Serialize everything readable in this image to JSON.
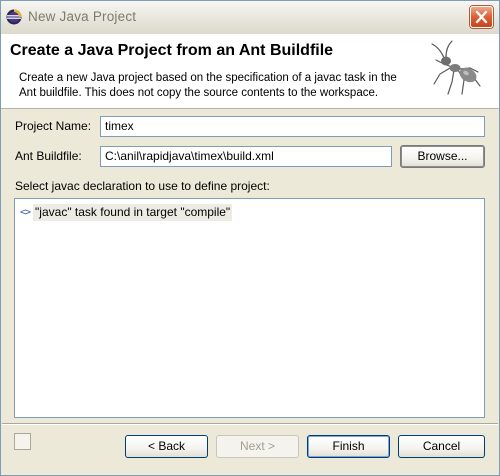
{
  "window": {
    "title": "New Java Project",
    "icon": "eclipse-icon",
    "close_icon": "close-icon"
  },
  "banner": {
    "title": "Create a Java Project from an Ant Buildfile",
    "description": "Create a new Java project based on the specification of a javac task in the Ant buildfile. This does not copy the source contents to the workspace.",
    "icon": "ant-icon"
  },
  "form": {
    "project_name_label": "Project Name:",
    "project_name_value": "timex",
    "ant_buildfile_label": "Ant Buildfile:",
    "ant_buildfile_value": "C:\\anil\\rapidjava\\timex\\build.xml",
    "browse_label": "Browse...",
    "javac_select_label": "Select javac declaration to use to define project:"
  },
  "javac_list": [
    {
      "icon": "javac-task-icon",
      "label": "\"javac\" task found in target \"compile\""
    }
  ],
  "buttons": {
    "back": "< Back",
    "next": "Next >",
    "finish": "Finish",
    "cancel": "Cancel"
  }
}
